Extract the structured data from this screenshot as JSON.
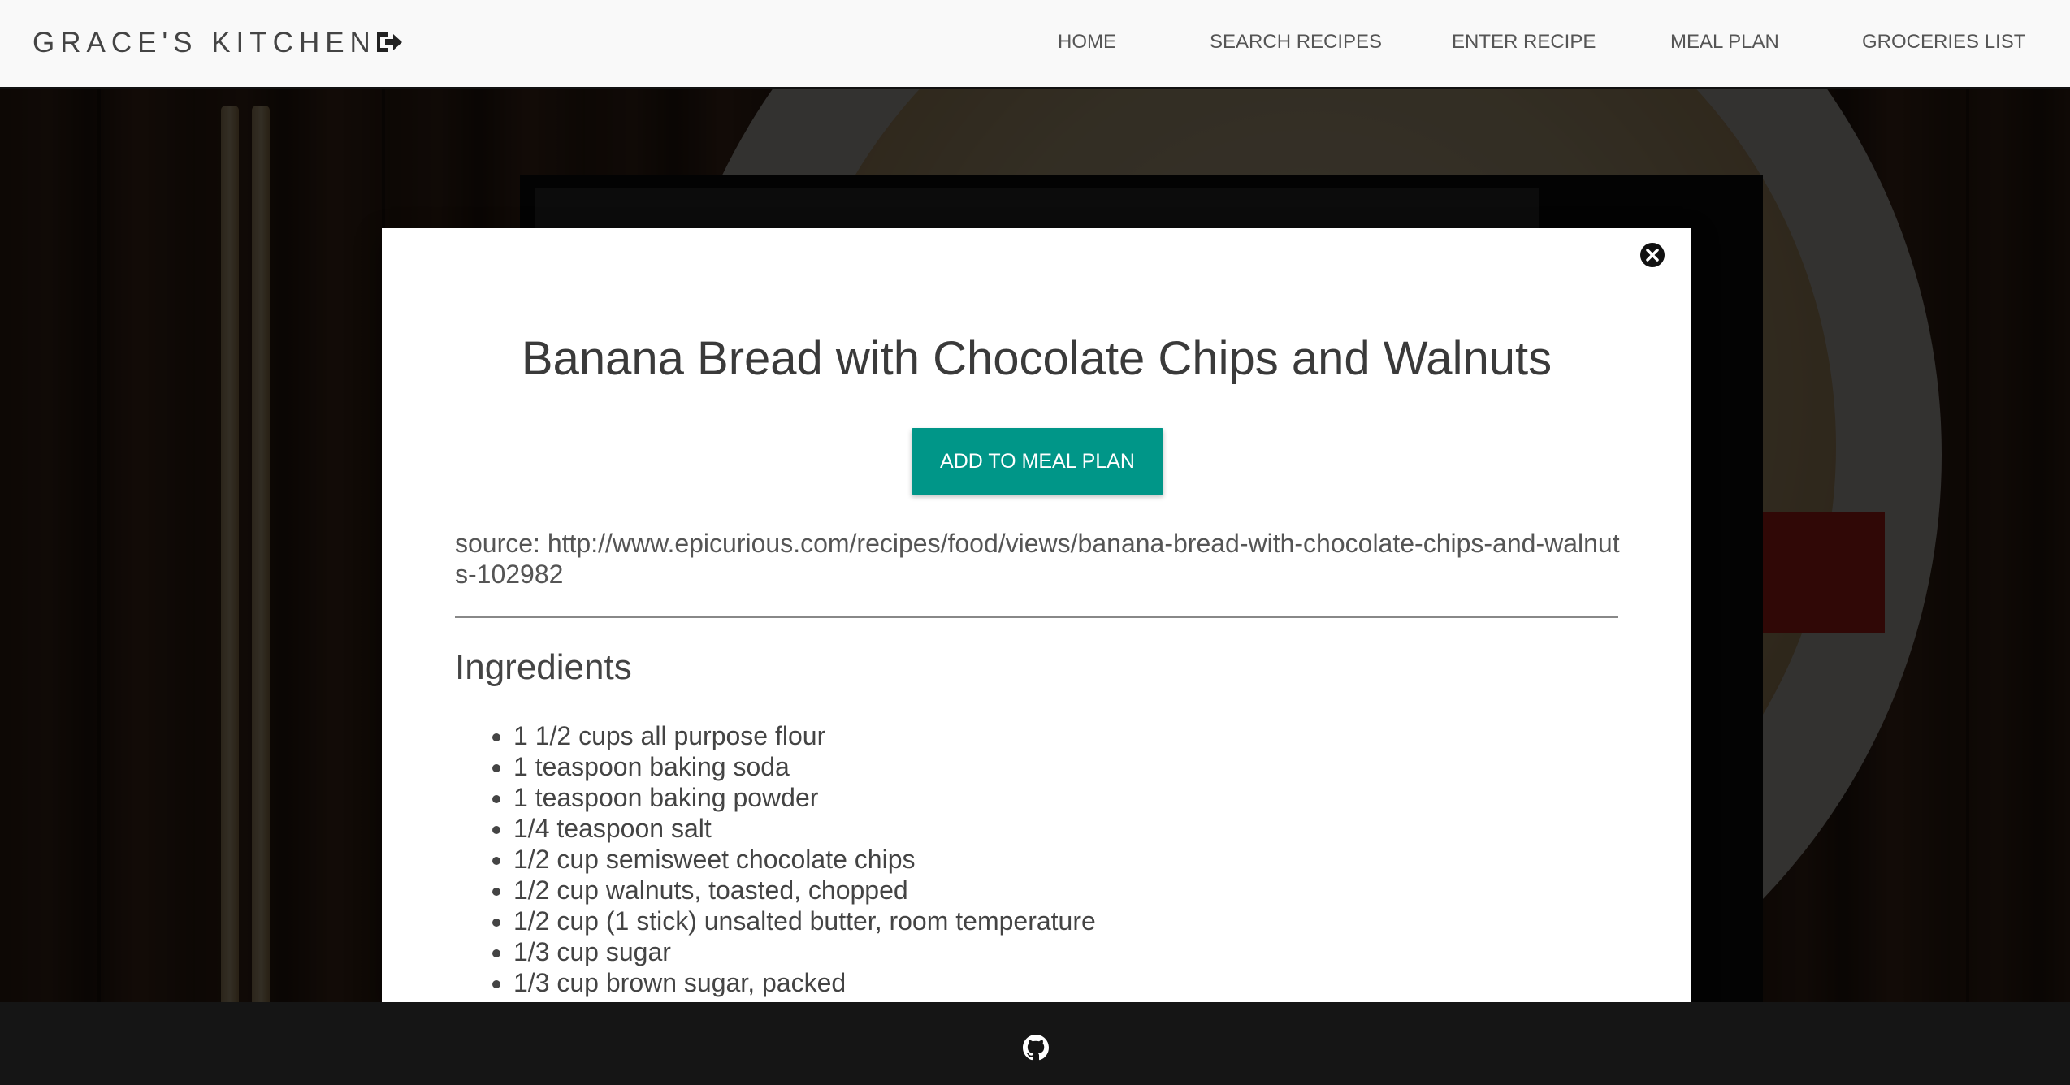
{
  "brand": {
    "name": "GRACE'S KITCHEN",
    "logout_icon": "sign-out-icon"
  },
  "nav": {
    "home": "HOME",
    "search_recipes": "SEARCH RECIPES",
    "enter_recipe": "ENTER RECIPE",
    "meal_plan": "MEAL PLAN",
    "groceries_list": "GROCERIES LIST"
  },
  "modal": {
    "close_icon": "close-circle-icon",
    "title": "Banana Bread with Chocolate Chips and Walnuts",
    "add_button_label": "ADD TO MEAL PLAN",
    "source_text": "source: http://www.epicurious.com/recipes/food/views/banana-bread-with-chocolate-chips-and-walnuts-102982",
    "ingredients_heading": "Ingredients",
    "ingredients": [
      "1 1/2 cups all purpose flour",
      "1 teaspoon baking soda",
      "1 teaspoon baking powder",
      "1/4 teaspoon salt",
      "1/2 cup semisweet chocolate chips",
      "1/2 cup walnuts, toasted, chopped",
      "1/2 cup (1 stick) unsalted butter, room temperature",
      "1/3 cup sugar",
      "1/3 cup brown sugar, packed"
    ]
  },
  "footer": {
    "github_icon": "github-icon"
  },
  "colors": {
    "accent": "#009688",
    "navbar_bg": "#f9f9f9",
    "footer_bg": "#151515",
    "text": "#444444"
  }
}
